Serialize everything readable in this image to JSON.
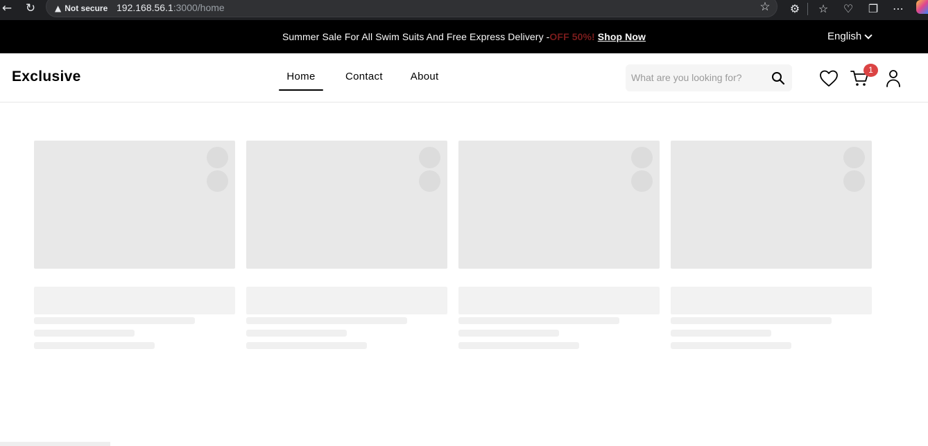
{
  "browser": {
    "security_label": "Not secure",
    "url_host": "192.168.56.1",
    "url_path": ":3000/home"
  },
  "announcement": {
    "text": "Summer Sale For All Swim Suits And Free Express Delivery -",
    "offer": "OFF 50%!",
    "cta": "Shop Now",
    "language": "English"
  },
  "header": {
    "logo": "Exclusive",
    "nav": [
      {
        "label": "Home",
        "active": true
      },
      {
        "label": "Contact"
      },
      {
        "label": "About"
      }
    ],
    "search_placeholder": "What are you looking for?",
    "cart_count": "1"
  },
  "colors": {
    "accent": "#db4444",
    "top_bar": "#000000",
    "skeleton": "#e8e8e8"
  },
  "icons": [
    "back-icon",
    "reload-icon",
    "warning-icon",
    "star-icon",
    "extensions-icon",
    "favorites-icon",
    "performance-icon",
    "collections-icon",
    "more-icon",
    "search-icon",
    "heart-icon",
    "cart-icon",
    "user-icon",
    "chevron-down-icon"
  ],
  "skeleton_cards": 4
}
